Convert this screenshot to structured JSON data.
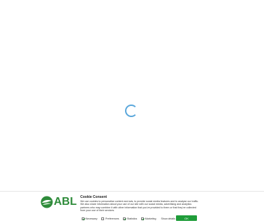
{
  "cookie": {
    "title": "Cookie Consent",
    "description": "We use cookies to personalise content and ads, to provide social media features and to analyse our traffic. We also share information about your use of our site with our social media, advertising and analytics partners who may combine it with other information that you've provided to them or that they've collected from your use of their services.",
    "options": [
      {
        "label": "Necessary",
        "checked": true
      },
      {
        "label": "Preferences",
        "checked": false
      },
      {
        "label": "Statistics",
        "checked": true
      },
      {
        "label": "Marketing",
        "checked": true
      }
    ],
    "details_label": "Show details",
    "ok_label": "OK"
  },
  "logo": {
    "text": "ABL"
  },
  "colors": {
    "brand_green": "#2e8b3a",
    "ok_button": "#1f9d3a",
    "spinner": "#5aa7db"
  }
}
